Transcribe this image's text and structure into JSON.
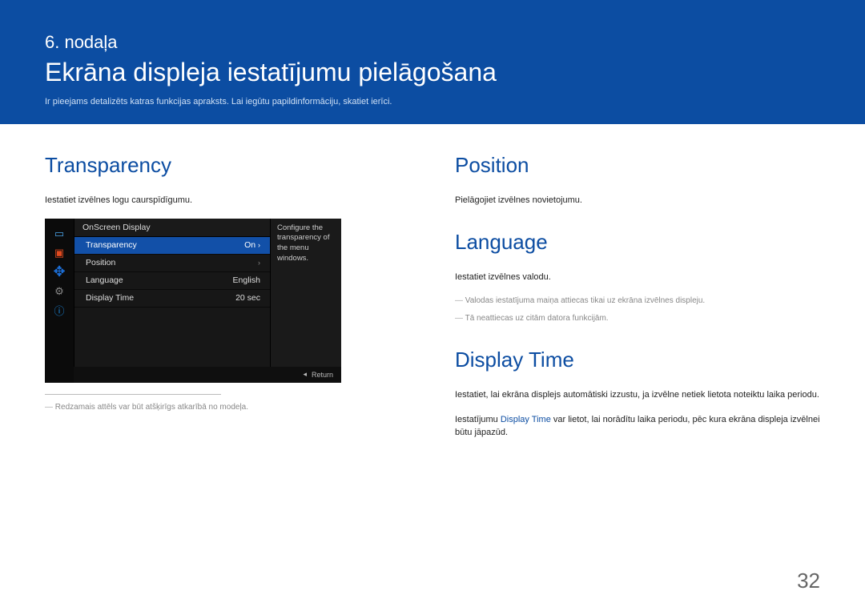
{
  "banner": {
    "chapter": "6. nodaļa",
    "title": "Ekrāna displeja iestatījumu pielāgošana",
    "subtitle": "Ir pieejams detalizēts katras funkcijas apraksts. Lai iegūtu papildinformāciju, skatiet ierīci."
  },
  "left": {
    "transparency": {
      "heading": "Transparency",
      "body": "Iestatiet izvēlnes logu caurspīdīgumu.",
      "disclaimer": "Redzamais attēls var būt atšķirīgs atkarībā no modeļa."
    }
  },
  "osd": {
    "header": "OnScreen Display",
    "rows": [
      {
        "label": "Transparency",
        "value": "On",
        "selected": true,
        "arrow": true
      },
      {
        "label": "Position",
        "value": "",
        "selected": false,
        "arrow": true
      },
      {
        "label": "Language",
        "value": "English",
        "selected": false,
        "arrow": false
      },
      {
        "label": "Display Time",
        "value": "20 sec",
        "selected": false,
        "arrow": false
      }
    ],
    "help": "Configure the transparency of the menu windows.",
    "footer_icon": "◂",
    "footer_label": "Return"
  },
  "right": {
    "position": {
      "heading": "Position",
      "body": "Pielāgojiet izvēlnes novietojumu."
    },
    "language": {
      "heading": "Language",
      "body": "Iestatiet izvēlnes valodu.",
      "note1": "Valodas iestatījuma maiņa attiecas tikai uz ekrāna izvēlnes displeju.",
      "note2": "Tā neattiecas uz citām datora funkcijām."
    },
    "display_time": {
      "heading": "Display Time",
      "body1": "Iestatiet, lai ekrāna displejs automātiski izzustu, ja izvēlne netiek lietota noteiktu laika periodu.",
      "body2a": "Iestatījumu ",
      "body2b": "Display Time",
      "body2c": " var lietot, lai norādītu laika periodu, pēc kura ekrāna displeja izvēlnei būtu jāpazūd."
    }
  },
  "page": "32"
}
